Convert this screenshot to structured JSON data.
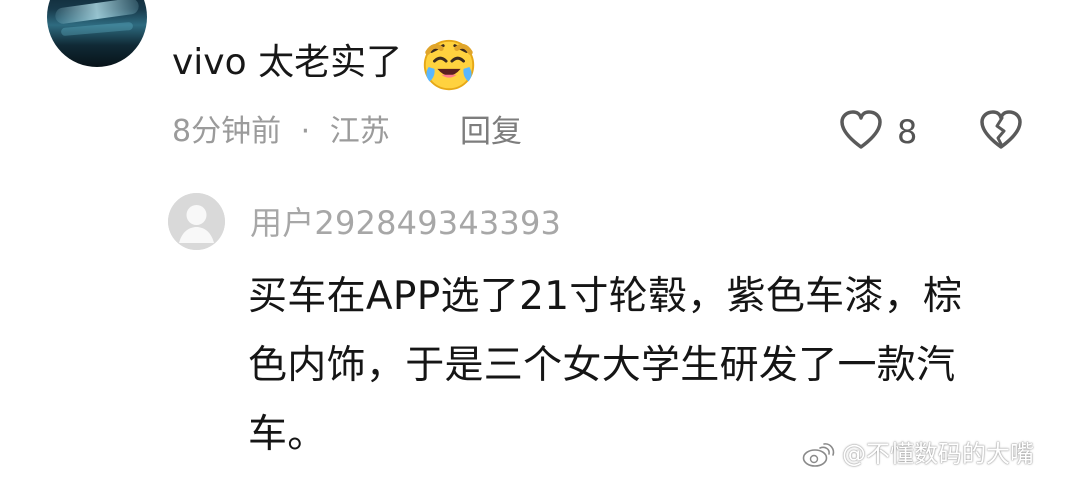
{
  "comment": {
    "author": "",
    "text": "vivo 太老实了",
    "emoji": "laughing-crying-face",
    "time": "8分钟前",
    "separator": "·",
    "location": "江苏",
    "reply_label": "回复",
    "likes": "8",
    "icons": {
      "like": "heart-icon",
      "dislike": "broken-heart-icon"
    }
  },
  "reply": {
    "username": "用户292849343393",
    "lines": [
      "买车在APP选了21寸轮毂，紫色车漆，棕",
      "色内饰，于是三个女大学生研发了一款汽",
      "车。"
    ]
  },
  "watermark": {
    "text": "@不懂数码的大嘴",
    "icon": "weibo-logo"
  },
  "colors": {
    "primary_text": "#171717",
    "secondary_text": "#9b9b9b",
    "username_text": "#a7a7a7",
    "background": "#ffffff"
  }
}
